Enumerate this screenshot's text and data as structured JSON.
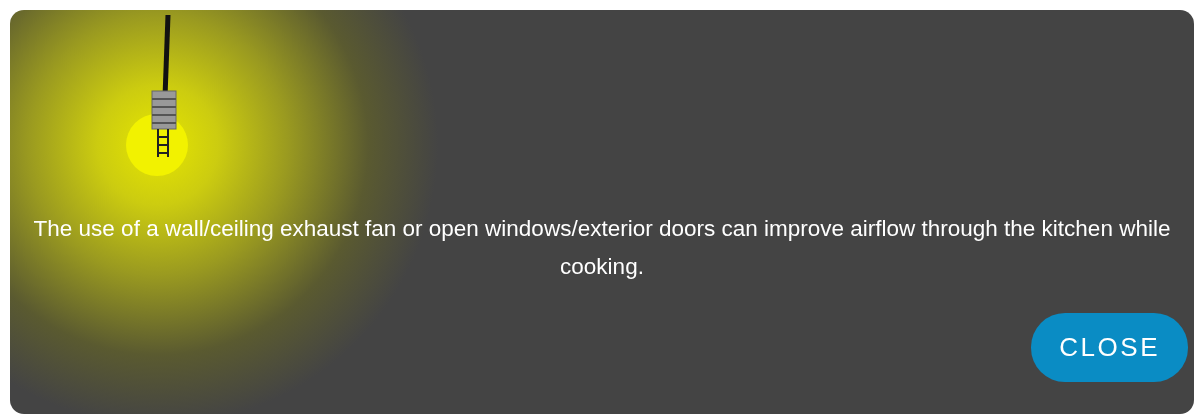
{
  "message": "The use of a wall/ceiling exhaust fan or open windows/exterior doors can improve airflow through the kitchen while cooking.",
  "close_button": {
    "label": "CLOSE"
  }
}
